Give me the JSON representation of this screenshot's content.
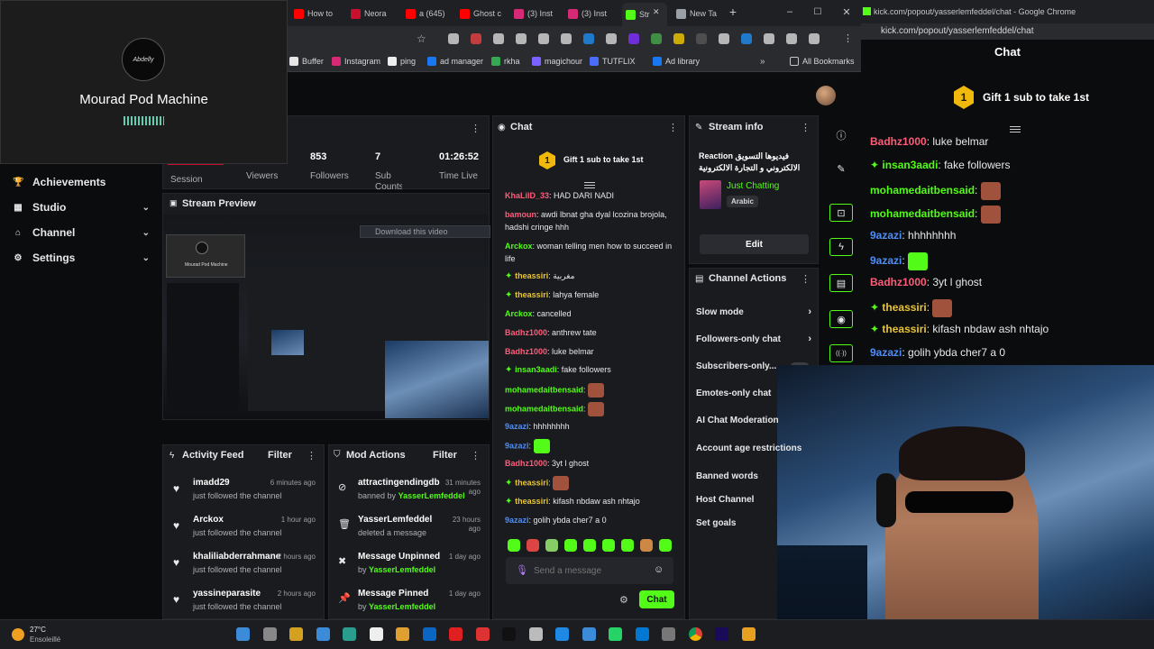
{
  "meet": {
    "name": "Mourad Pod Machine",
    "avatar_text": "Abdelly"
  },
  "browser": {
    "tabs": [
      {
        "label": "How to",
        "color": "#ff0000"
      },
      {
        "label": "Neora",
        "color": "#c8102e"
      },
      {
        "label": "a (645)",
        "color": "#ff0000"
      },
      {
        "label": "Ghost c",
        "color": "#ff0000"
      },
      {
        "label": "(3) Inst",
        "color": "#d62976"
      },
      {
        "label": "(3) Inst",
        "color": "#d62976"
      },
      {
        "label": "Str",
        "color": "#53fc18"
      },
      {
        "label": "New Ta",
        "color": "#9aa0a6"
      }
    ],
    "bookmarks": [
      {
        "label": "Buffer",
        "color": "#e6e6e6"
      },
      {
        "label": "Instagram",
        "color": "#d62976"
      },
      {
        "label": "ping",
        "color": "#eeeeee"
      },
      {
        "label": "ad manager",
        "color": "#1877f2"
      },
      {
        "label": "rkha",
        "color": "#34a853"
      },
      {
        "label": "magichour",
        "color": "#7b61ff"
      },
      {
        "label": "TUTFLIX",
        "color": "#4a6cf7"
      },
      {
        "label": "Ad library",
        "color": "#1877f2"
      }
    ],
    "all_bookmarks": "All Bookmarks"
  },
  "sidebar": {
    "items": [
      {
        "label": "Achievements",
        "chevron": false
      },
      {
        "label": "Studio",
        "chevron": true
      },
      {
        "label": "Channel",
        "chevron": true
      },
      {
        "label": "Settings",
        "chevron": true
      }
    ]
  },
  "stats": {
    "session_label": "Session",
    "viewers_label": "Viewers",
    "followers_value": "853",
    "followers_label": "Followers",
    "subs_value": "7",
    "subs_label": "Sub Counts",
    "time_value": "01:26:52",
    "time_label": "Time Live"
  },
  "preview": {
    "title": "Stream Preview",
    "download": "Download this video"
  },
  "activity": {
    "title": "Activity Feed",
    "filter": "Filter",
    "rows": [
      {
        "name": "imadd29",
        "sub": "just followed the channel",
        "time": "6 minutes ago"
      },
      {
        "name": "Arckox",
        "sub": "just followed the channel",
        "time": "1 hour ago"
      },
      {
        "name": "khaliliabderrahmane",
        "sub": "just followed the channel",
        "time": "2 hours ago"
      },
      {
        "name": "yassineparasite",
        "sub": "just followed the channel",
        "time": "2 hours ago"
      }
    ]
  },
  "mod": {
    "title": "Mod Actions",
    "filter": "Filter",
    "rows": [
      {
        "name": "attractingendingdb",
        "pre": "banned by",
        "by": "YasserLemfeddel",
        "time": "31 minutes ago"
      },
      {
        "name": "YasserLemfeddel",
        "pre": "deleted a message",
        "by": "",
        "time": "23 hours ago"
      },
      {
        "name": "Message Unpinned",
        "pre": "by",
        "by": "YasserLemfeddel",
        "time": "1 day ago"
      },
      {
        "name": "Message Pinned",
        "pre": "by",
        "by": "YasserLemfeddel",
        "time": "1 day ago"
      }
    ]
  },
  "chat": {
    "title": "Chat",
    "gift": "Gift 1 sub to take 1st",
    "gift_badge": "1",
    "messages": [
      {
        "user": "KhaLilD_33",
        "text": "HAD DARI NADI",
        "color": "#ff5c7a",
        "badge": false
      },
      {
        "user": "bamoun",
        "text": "awdi lbnat gha dyal lcozina brojola, hadshi cringe hhh",
        "color": "#ff5c7a",
        "badge": false
      },
      {
        "user": "Arckox",
        "text": "woman telling men how to succeed in life",
        "color": "#53fc18",
        "badge": false
      },
      {
        "user": "theassiri",
        "text": "مغربية",
        "color": "#e9c534",
        "badge": true
      },
      {
        "user": "theassiri",
        "text": "lahya female",
        "color": "#e9c534",
        "badge": true
      },
      {
        "user": "Arckox",
        "text": "cancelled",
        "color": "#53fc18",
        "badge": false
      },
      {
        "user": "Badhz1000",
        "text": "anthrew tate",
        "color": "#ff5c7a",
        "badge": false
      },
      {
        "user": "Badhz1000",
        "text": "luke belmar",
        "color": "#ff5c7a",
        "badge": false
      },
      {
        "user": "insan3aadi",
        "text": "fake followers",
        "color": "#53fc18",
        "badge": true
      },
      {
        "user": "mohamedaitbensaid",
        "text": "",
        "color": "#53fc18",
        "badge": false
      },
      {
        "user": "mohamedaitbensaid",
        "text": "",
        "color": "#53fc18",
        "badge": false
      },
      {
        "user": "9azazi",
        "text": "hhhhhhhh",
        "color": "#4f8df7",
        "badge": false
      },
      {
        "user": "9azazi",
        "text": "",
        "color": "#4f8df7",
        "badge": false
      },
      {
        "user": "Badhz1000",
        "text": "3yt l ghost",
        "color": "#ff5c7a",
        "badge": false
      },
      {
        "user": "theassiri",
        "text": "",
        "color": "#e9c534",
        "badge": true
      },
      {
        "user": "theassiri",
        "text": "kifash nbdaw ash nhtajo",
        "color": "#e9c534",
        "badge": true
      },
      {
        "user": "9azazi",
        "text": "golih ybda cher7 a 0",
        "color": "#4f8df7",
        "badge": false
      }
    ],
    "placeholder": "Send a message",
    "send_label": "Chat"
  },
  "stream_info": {
    "title": "Stream info",
    "stream_title": "Reaction فيديوها التسويق الالكتروني و التجارة الالكترونية",
    "category": "Just Chatting",
    "language": "Arabic",
    "edit": "Edit"
  },
  "channel_actions": {
    "title": "Channel Actions",
    "items": [
      {
        "label": "Slow mode",
        "arrow": true
      },
      {
        "label": "Followers-only chat",
        "arrow": true
      },
      {
        "label": "Subscribers-only...",
        "arrow": false
      },
      {
        "label": "Emotes-only chat",
        "arrow": false
      },
      {
        "label": "AI Chat Moderation",
        "arrow": false
      },
      {
        "label": "Account age restrictions",
        "arrow": false
      },
      {
        "label": "Banned words",
        "arrow": false
      },
      {
        "label": "Host Channel",
        "arrow": false
      },
      {
        "label": "Set goals",
        "arrow": false
      }
    ]
  },
  "popout": {
    "window_title": "kick.com/popout/yasserlemfeddel/chat - Google Chrome",
    "url": "kick.com/popout/yasserlemfeddel/chat",
    "chat_title": "Chat",
    "gift": "Gift 1 sub to take 1st",
    "gift_badge": "1",
    "messages": [
      {
        "user": "Badhz1000",
        "text": "luke belmar",
        "color": "#ff5c7a",
        "badge": false
      },
      {
        "user": "insan3aadi",
        "text": "fake followers",
        "color": "#53fc18",
        "badge": true
      },
      {
        "user": "mohamedaitbensaid",
        "text": "",
        "color": "#53fc18",
        "badge": false
      },
      {
        "user": "mohamedaitbensaid",
        "text": "",
        "color": "#53fc18",
        "badge": false
      },
      {
        "user": "9azazi",
        "text": "hhhhhhhh",
        "color": "#4f8df7",
        "badge": false
      },
      {
        "user": "9azazi",
        "text": "",
        "color": "#4f8df7",
        "badge": false
      },
      {
        "user": "Badhz1000",
        "text": "3yt l ghost",
        "color": "#ff5c7a",
        "badge": false
      },
      {
        "user": "theassiri",
        "text": "",
        "color": "#e9c534",
        "badge": true
      },
      {
        "user": "theassiri",
        "text": "kifash nbdaw ash nhtajo",
        "color": "#e9c534",
        "badge": true
      },
      {
        "user": "9azazi",
        "text": "golih ybda cher7 a 0",
        "color": "#4f8df7",
        "badge": false
      }
    ]
  },
  "taskbar": {
    "temp": "27°C",
    "weather": "Ensoleillé"
  },
  "colors": {
    "kick_green": "#53fc18",
    "gold": "#f0b90b"
  }
}
